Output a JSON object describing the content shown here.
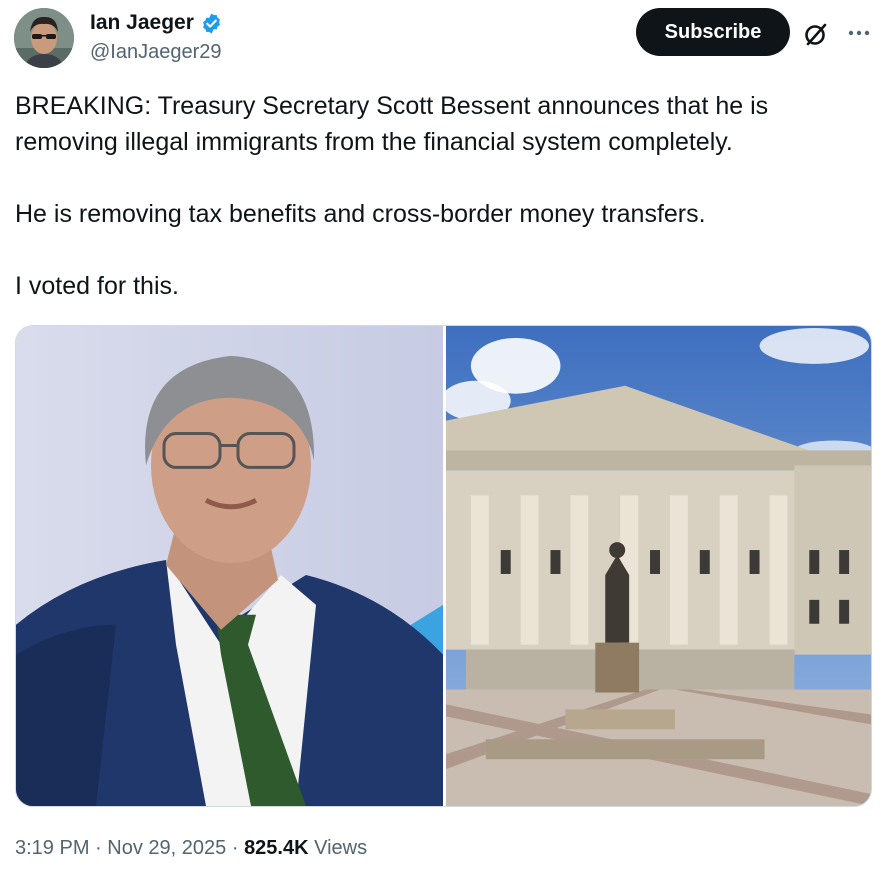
{
  "author": {
    "display_name": "Ian Jaeger",
    "handle": "@IanJaeger29",
    "verified": true
  },
  "header": {
    "subscribe_label": "Subscribe",
    "grok_icon": "grok-slash-icon",
    "more_icon": "more-dots-icon"
  },
  "tweet": {
    "paragraphs": [
      "BREAKING: Treasury Secretary Scott Bessent announces that he is removing illegal immigrants from the financial system completely.",
      "He is removing tax benefits and cross-border money transfers.",
      "I voted for this."
    ]
  },
  "media": {
    "count": 2
  },
  "meta": {
    "time": "3:19 PM",
    "separator": "·",
    "date": "Nov 29, 2025",
    "views_count": "825.4K",
    "views_label": "Views"
  },
  "colors": {
    "accent": "#1d9bf0",
    "text": "#0f1419",
    "secondary": "#536471",
    "button_bg": "#0f1419"
  }
}
